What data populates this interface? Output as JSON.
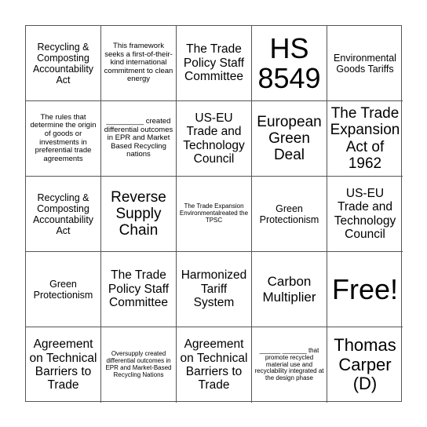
{
  "board": {
    "cells": [
      {
        "text": "Recycling & Composting Accountability Act"
      },
      {
        "text": "This framework seeks a first-of-their-kind international commitment to clean energy"
      },
      {
        "text": "The Trade Policy Staff Committee"
      },
      {
        "text": "HS 8549"
      },
      {
        "text": "Environmental Goods Tariffs"
      },
      {
        "text": "The rules that determine the origin of goods or investments in preferential trade agreements"
      },
      {
        "text": "_________ created differential outcomes in EPR and Market Based Recycling nations"
      },
      {
        "text": "US-EU Trade and Technology Council"
      },
      {
        "text": "European Green Deal"
      },
      {
        "text": "The Trade Expansion Act of 1962"
      },
      {
        "text": "Recycling & Composting Accountability Act"
      },
      {
        "text": "Reverse Supply Chain"
      },
      {
        "text": "The Trade Expansion Environmentalreated the TPSC"
      },
      {
        "text": "Green Protectionism"
      },
      {
        "text": "US-EU Trade and Technology Council"
      },
      {
        "text": "Green Protectionism"
      },
      {
        "text": "The Trade Policy Staff Committee"
      },
      {
        "text": "Harmonized Tariff System"
      },
      {
        "text": "Carbon Multiplier"
      },
      {
        "text": "Free!"
      },
      {
        "text": "Agreement on Technical Barriers to Trade"
      },
      {
        "text": "Oversupply created differential outcomes in EPR and Market-Based Recycling Nations"
      },
      {
        "text": "Agreement on Technical Barriers to Trade"
      },
      {
        "text": "______ _______ that promote recycled material use and recyclability integrated at the design phase"
      },
      {
        "text": "Thomas Carper (D)"
      }
    ]
  }
}
